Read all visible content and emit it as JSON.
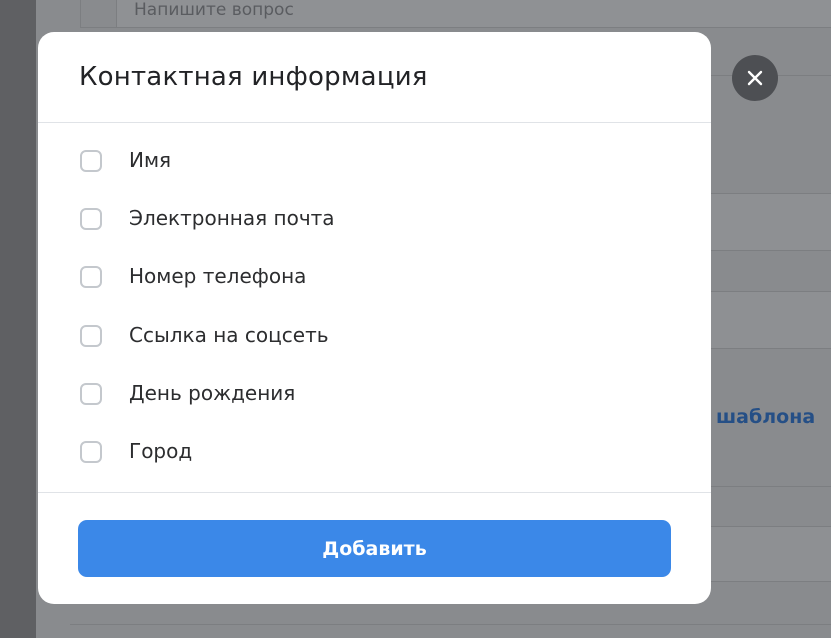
{
  "background": {
    "question_placeholder": "Напишите вопрос",
    "link_fragment": "шаблона"
  },
  "modal": {
    "title": "Контактная информация",
    "options": [
      {
        "label": "Имя",
        "checked": false
      },
      {
        "label": "Электронная почта",
        "checked": false
      },
      {
        "label": "Номер телефона",
        "checked": false
      },
      {
        "label": "Ссылка на соцсеть",
        "checked": false
      },
      {
        "label": "День рождения",
        "checked": false
      },
      {
        "label": "Город",
        "checked": false
      }
    ],
    "submit_label": "Добавить"
  },
  "icons": {
    "close": "close-icon"
  },
  "colors": {
    "primary_button": "#3b88e8",
    "overlay": "#898b8e",
    "close_button": "#4d4f53",
    "link": "#254f86"
  }
}
